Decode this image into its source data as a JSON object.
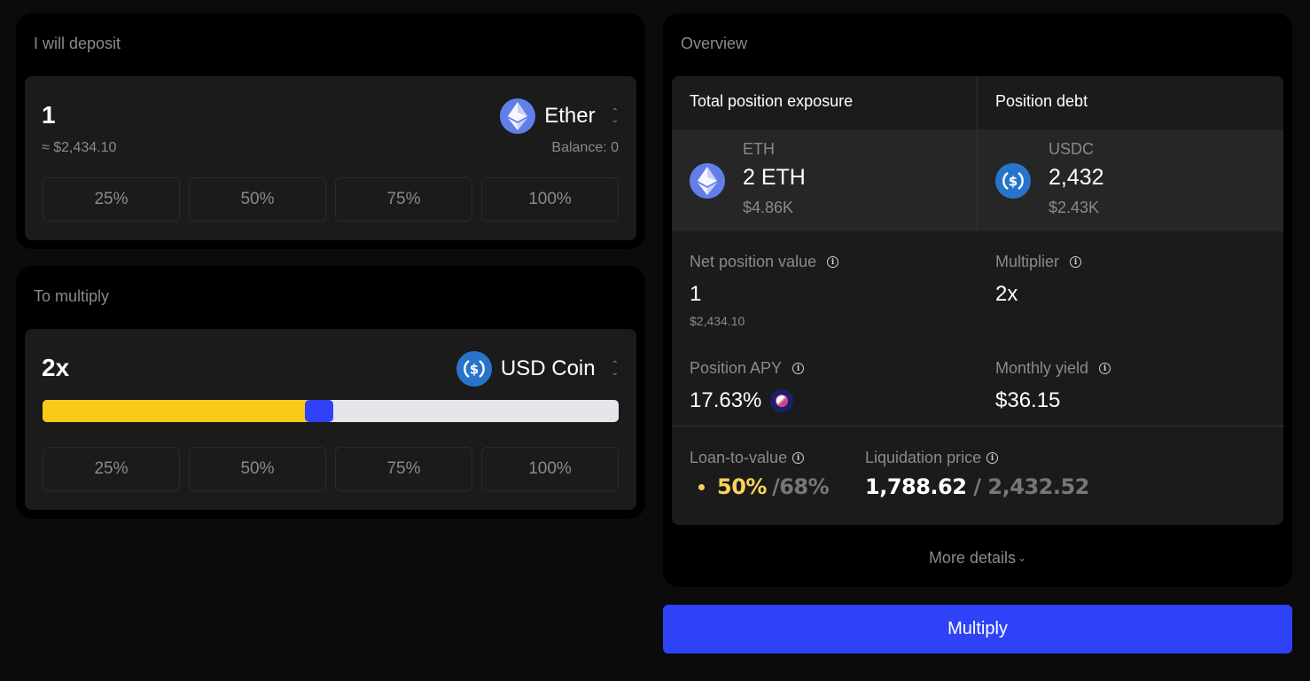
{
  "deposit": {
    "title": "I will deposit",
    "amount": "1",
    "usd_approx": "≈ $2,434.10",
    "token": {
      "name": "Ether",
      "icon": "ether-icon",
      "color": "#627eea"
    },
    "balance": "Balance: 0",
    "percent_buttons": [
      "25%",
      "50%",
      "75%",
      "100%"
    ]
  },
  "multiply": {
    "title": "To multiply",
    "multiplier": "2x",
    "token": {
      "name": "USD Coin",
      "icon": "usdc-icon",
      "color": "#2775ca"
    },
    "slider": {
      "value_fraction": 0.48,
      "fill_color": "#f9cb18",
      "thumb_color": "#2f42f8",
      "track_color": "#e5e6ea"
    },
    "percent_buttons": [
      "25%",
      "50%",
      "75%",
      "100%"
    ]
  },
  "overview": {
    "title": "Overview",
    "exposure": {
      "header": "Total position exposure",
      "symbol": "ETH",
      "amount": "2 ETH",
      "usd": "$4.86K",
      "icon": "ether-icon"
    },
    "debt": {
      "header": "Position debt",
      "symbol": "USDC",
      "amount": "2,432",
      "usd": "$2.43K",
      "icon": "usdc-icon"
    },
    "net_position": {
      "label": "Net position value",
      "value": "1",
      "sub": "$2,434.10"
    },
    "multiplier": {
      "label": "Multiplier",
      "value": "2x"
    },
    "apy": {
      "label": "Position APY",
      "value": "17.63%",
      "badge_icon": "rewards-badge-icon"
    },
    "monthly_yield": {
      "label": "Monthly yield",
      "value": "$36.15"
    },
    "ltv": {
      "label": "Loan-to-value",
      "current": "50%",
      "max": "/68%",
      "current_color": "#fcd15a"
    },
    "liquidation": {
      "label": "Liquidation price",
      "value": "1,788.62",
      "separator": " / ",
      "current": "2,432.52"
    },
    "more_details": "More details"
  },
  "actions": {
    "multiply_label": "Multiply",
    "accent": "#2f42f8"
  }
}
